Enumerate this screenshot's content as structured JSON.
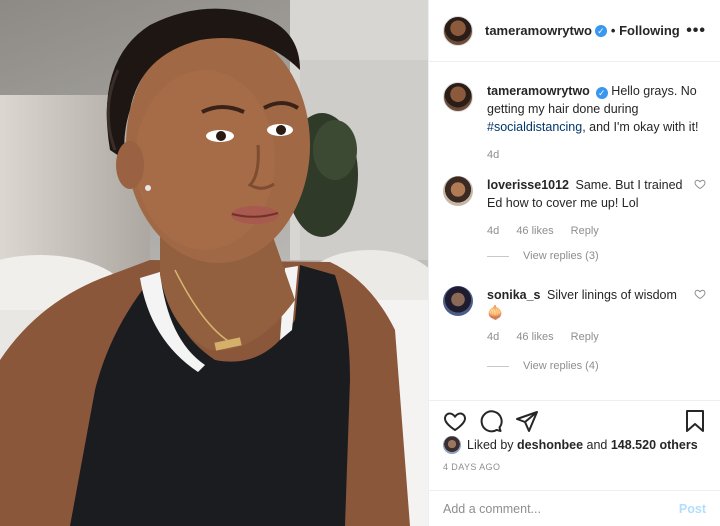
{
  "post": {
    "image_alt": "selfie-photo",
    "author": "tameramowrytwo",
    "follow_state": "• Following",
    "more": "•••"
  },
  "caption": {
    "username": "tameramowrytwo",
    "text_before": "Hello grays. No getting my hair done during ",
    "hashtag": "#socialdistancing",
    "text_after": ", and I'm okay with it!",
    "time": "4d"
  },
  "comments": [
    {
      "username": "loverisse1012",
      "text": "Same. But I trained Ed how to cover me up! Lol",
      "time": "4d",
      "likes": "46 likes",
      "reply": "Reply",
      "view_replies": "View replies (3)"
    },
    {
      "username": "sonika_s",
      "text": "Silver linings of wisdom",
      "emoji": "🧅",
      "time": "4d",
      "likes": "46 likes",
      "reply": "Reply",
      "view_replies": "View replies (4)"
    }
  ],
  "likes_line": {
    "prefix": "Liked by ",
    "user": "deshonbee",
    "middle": " and ",
    "count": "148.520 others"
  },
  "date": "4 DAYS AGO",
  "composer": {
    "placeholder": "Add a comment...",
    "post_label": "Post"
  },
  "icons": [
    "heart-icon",
    "comment-icon",
    "share-icon",
    "bookmark-icon",
    "verified-icon",
    "more-icon"
  ],
  "colors": {
    "link": "#00376b",
    "verified": "#3897f0",
    "muted": "#8e8e8e",
    "post_disabled": "#b2dffc"
  }
}
